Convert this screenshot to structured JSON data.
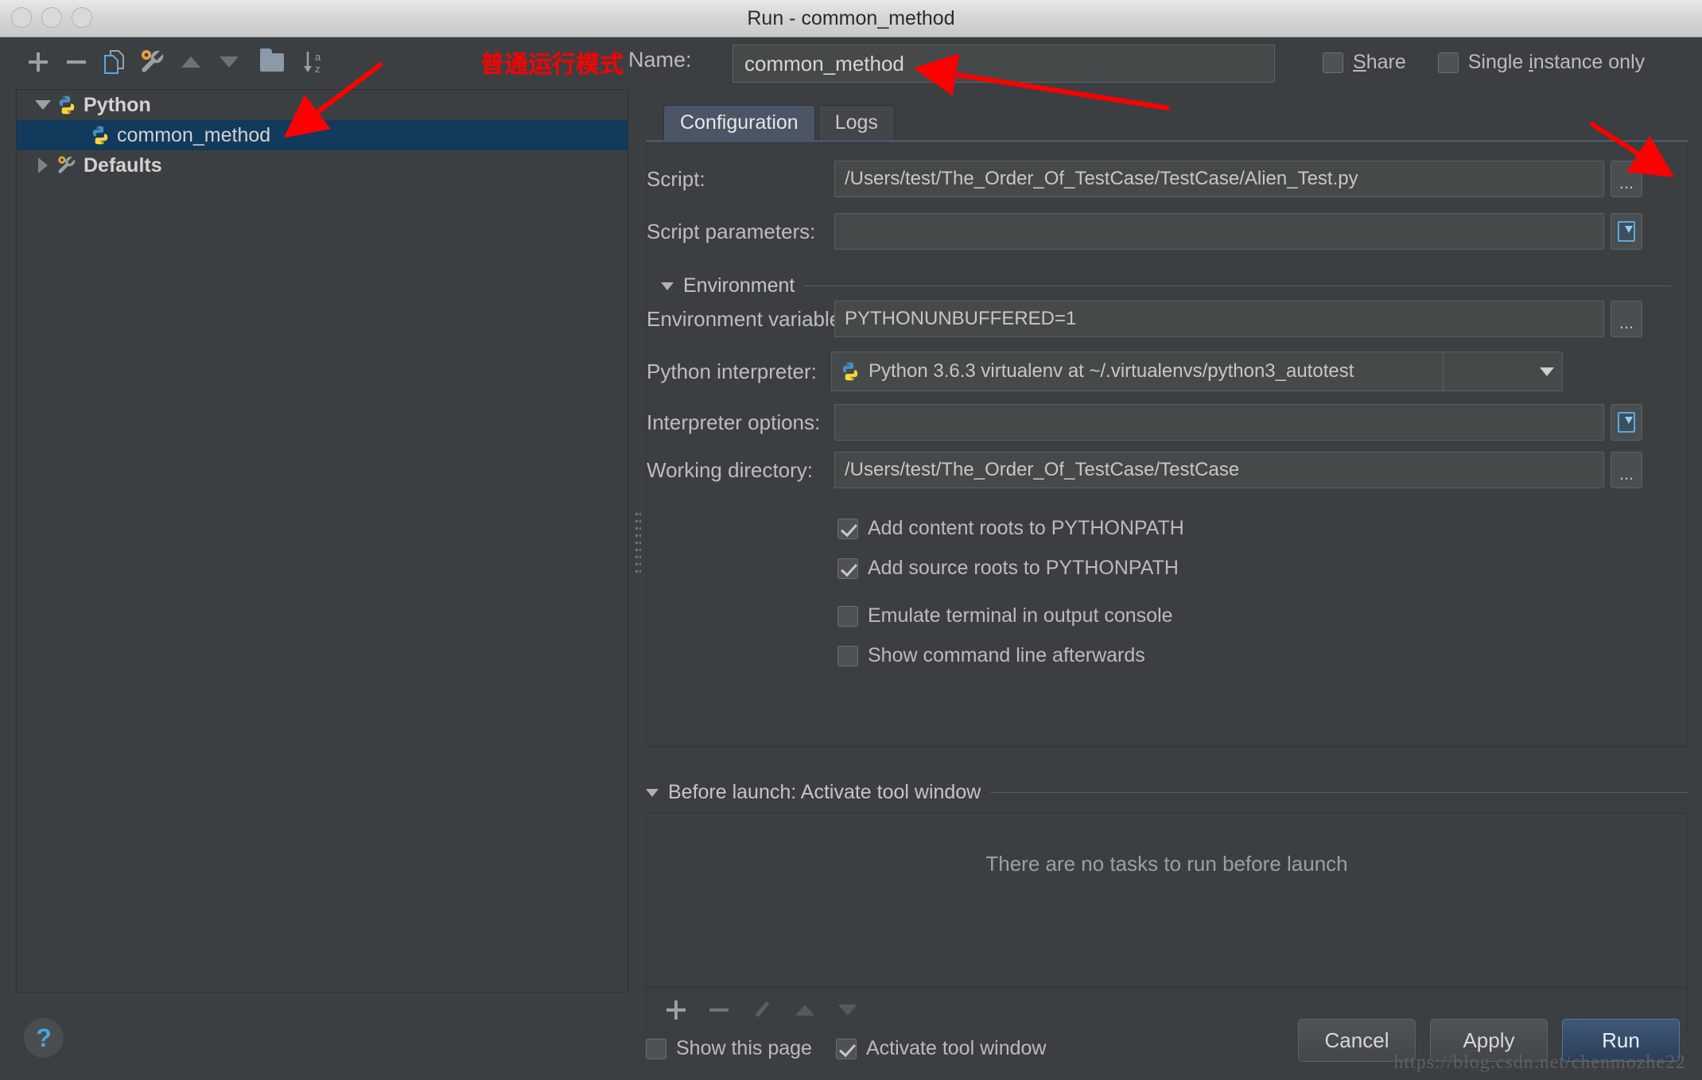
{
  "window": {
    "title": "Run - common_method",
    "traffic_lights": [
      "close",
      "minimize",
      "zoom"
    ]
  },
  "toolbar": {
    "buttons": [
      {
        "name": "add",
        "icon": "plus-icon"
      },
      {
        "name": "remove",
        "icon": "minus-icon"
      },
      {
        "name": "copy",
        "icon": "copy-icon"
      },
      {
        "name": "edit-defaults",
        "icon": "wrench-icon"
      },
      {
        "name": "move-up",
        "icon": "arrow-up-icon"
      },
      {
        "name": "move-down",
        "icon": "arrow-down-icon"
      },
      {
        "name": "new-folder",
        "icon": "folder-icon"
      },
      {
        "name": "sort-alphabetically",
        "icon": "sort-az-icon"
      }
    ]
  },
  "annotation": {
    "chinese_label": "普通运行模式",
    "color": "#ff0000"
  },
  "name_row": {
    "label": "Name:",
    "value": "common_method",
    "placeholder": ""
  },
  "top_checkboxes": [
    {
      "label": "Share",
      "underline_char": "S",
      "checked": false
    },
    {
      "label": "Single instance only",
      "underline_char": "i",
      "checked": false
    }
  ],
  "tree": {
    "items": [
      {
        "label": "Python",
        "level": 0,
        "expanded": true,
        "selected": false,
        "icon": "python-icon",
        "bold": true
      },
      {
        "label": "common_method",
        "level": 1,
        "expanded": null,
        "selected": true,
        "icon": "python-icon",
        "bold": false
      },
      {
        "label": "Defaults",
        "level": 0,
        "expanded": false,
        "selected": false,
        "icon": "wrench-icon",
        "bold": true
      }
    ]
  },
  "tabs": [
    {
      "label": "Configuration",
      "active": true
    },
    {
      "label": "Logs",
      "active": false
    }
  ],
  "fields": {
    "script": {
      "label": "Script:",
      "value": "/Users/test/The_Order_Of_TestCase/TestCase/Alien_Test.py",
      "button": "..."
    },
    "script_parameters": {
      "label": "Script parameters:",
      "value": "",
      "button": "expand-icon"
    },
    "environment_section": {
      "label": "Environment",
      "expanded": true
    },
    "environment_variables": {
      "label": "Environment variables:",
      "value": "PYTHONUNBUFFERED=1",
      "button": "..."
    },
    "python_interpreter": {
      "label": "Python interpreter:",
      "value": "Python 3.6.3 virtualenv at ~/.virtualenvs/python3_autotest",
      "icon": "python-icon"
    },
    "interpreter_options": {
      "label": "Interpreter options:",
      "value": "",
      "button": "expand-icon"
    },
    "working_directory": {
      "label": "Working directory:",
      "value": "/Users/test/The_Order_Of_TestCase/TestCase",
      "button": "..."
    }
  },
  "config_checkboxes": [
    {
      "label": "Add content roots to PYTHONPATH",
      "checked": true
    },
    {
      "label": "Add source roots to PYTHONPATH",
      "checked": true
    },
    {
      "label": "Emulate terminal in output console",
      "checked": false
    },
    {
      "label": "Show command line afterwards",
      "checked": false
    }
  ],
  "before_launch": {
    "section_label": "Before launch: Activate tool window",
    "expanded": true,
    "empty_message": "There are no tasks to run before launch",
    "toolbar_buttons": [
      {
        "name": "add-task",
        "icon": "plus-icon"
      },
      {
        "name": "remove-task",
        "icon": "minus-icon"
      },
      {
        "name": "edit-task",
        "icon": "pencil-icon"
      },
      {
        "name": "move-task-up",
        "icon": "arrow-up-icon"
      },
      {
        "name": "move-task-down",
        "icon": "arrow-down-icon"
      }
    ]
  },
  "bottom_checkboxes": [
    {
      "label": "Show this page",
      "checked": false
    },
    {
      "label": "Activate tool window",
      "checked": true
    }
  ],
  "footer": {
    "help": "?",
    "buttons": [
      {
        "label": "Cancel",
        "primary": false
      },
      {
        "label": "Apply",
        "primary": false
      },
      {
        "label": "Run",
        "primary": true
      }
    ]
  },
  "watermark": "https://blog.csdn.net/chenmozhe22",
  "colors": {
    "window_bg": "#3c3f41",
    "field_bg": "#45494a",
    "selection_blue": "#113a5c",
    "tab_active": "#4b5565",
    "primary_button": "#2c3f58",
    "accent_red": "#ff0000",
    "text": "#bbbbbb"
  }
}
